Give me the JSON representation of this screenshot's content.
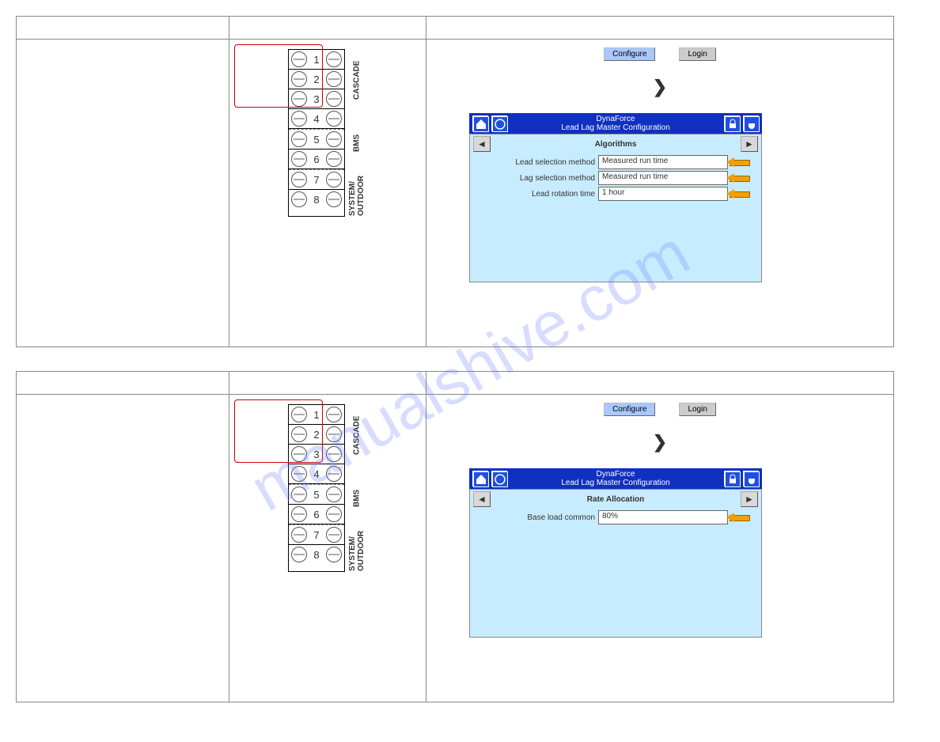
{
  "watermark": "manualshive.com",
  "terminals": {
    "rows": [
      "1",
      "2",
      "3",
      "4",
      "5",
      "6",
      "7",
      "8"
    ],
    "cascade_label": "CASCADE",
    "bms_label": "BMS",
    "system_label": "SYSTEM/\nOUTDOOR"
  },
  "buttons": {
    "configure": "Configure",
    "login": "Login"
  },
  "chevron": "❯",
  "hmi": {
    "brand": "DynaForce",
    "title": "Lead Lag Master Configuration"
  },
  "panel1": {
    "subtitle": "Algorithms",
    "f1_label": "Lead selection method",
    "f1_value": "Measured run time",
    "f2_label": "Lag selection method",
    "f2_value": "Measured run time",
    "f3_label": "Lead rotation time",
    "f3_value": "1 hour"
  },
  "panel2": {
    "subtitle": "Rate Allocation",
    "f1_label": "Base load common",
    "f1_value": "80%"
  },
  "body2_height_shorter": true
}
